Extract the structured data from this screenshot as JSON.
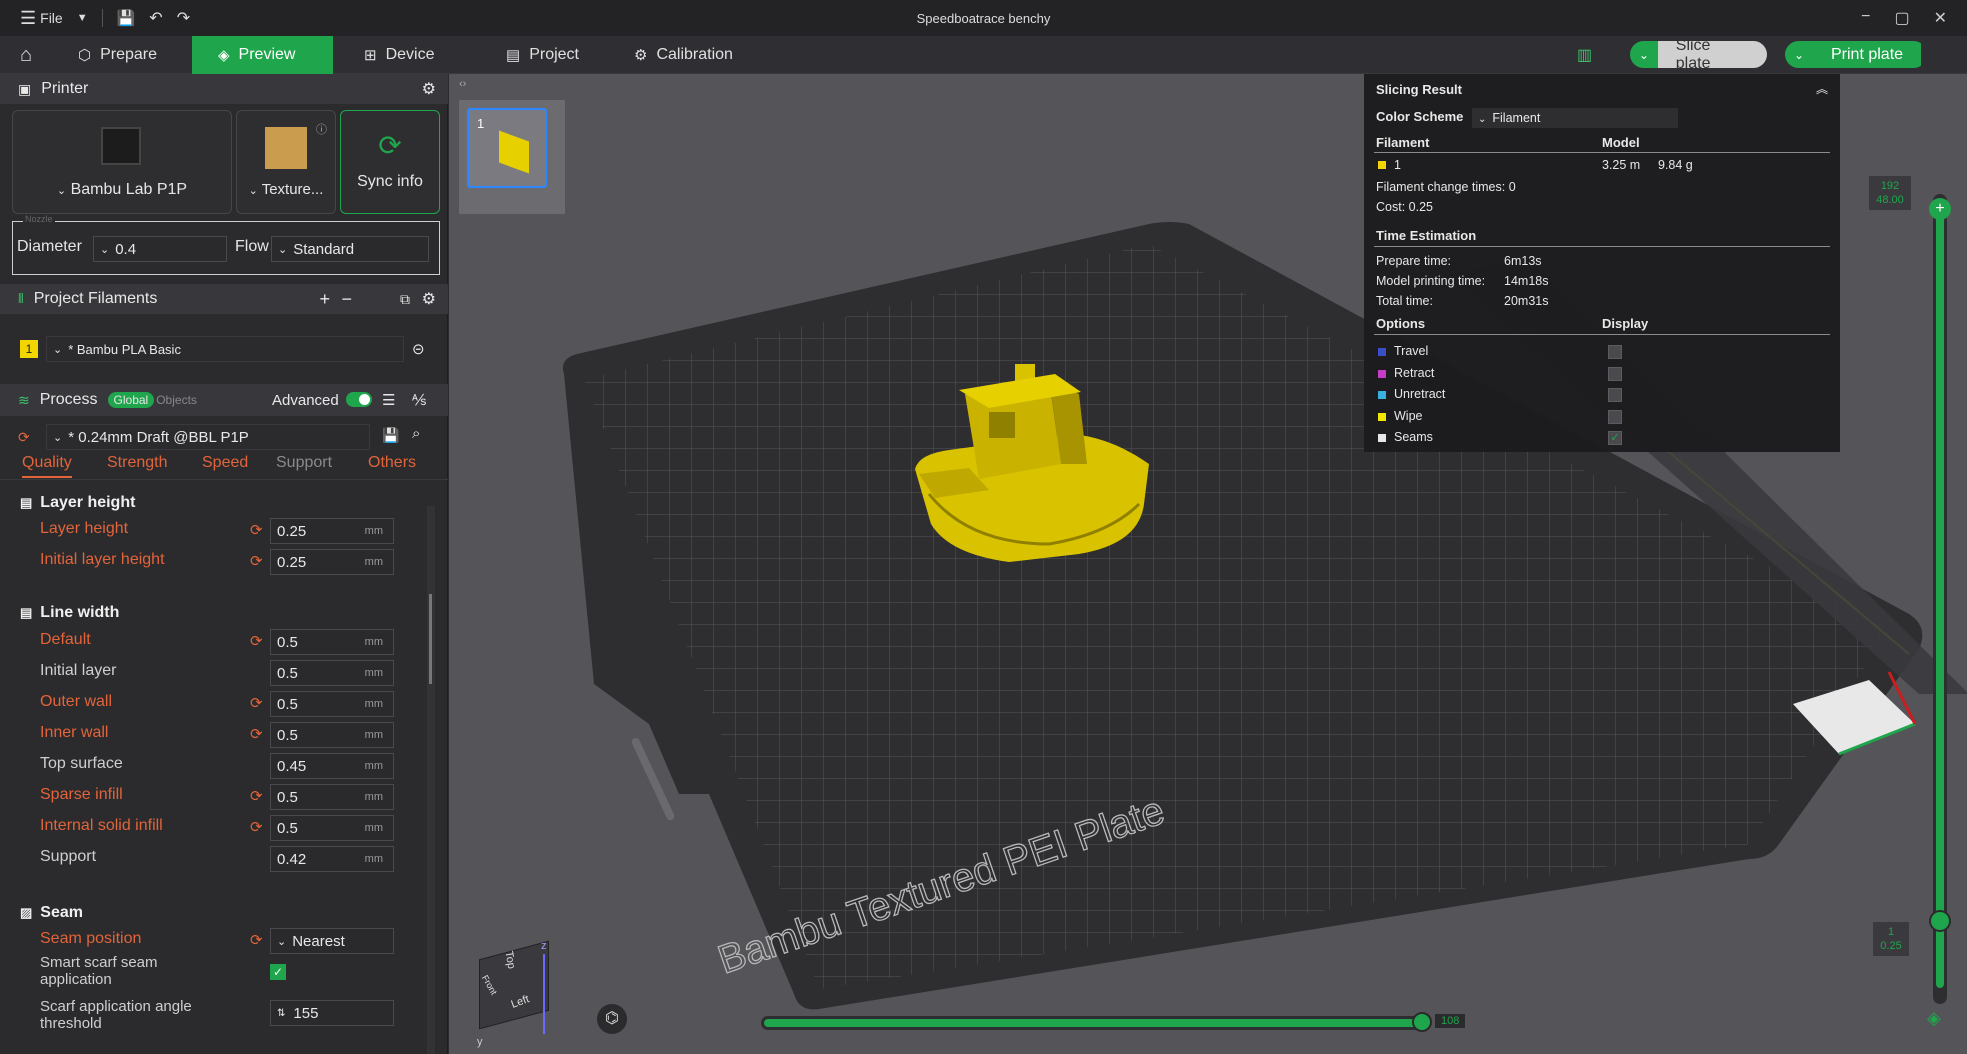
{
  "window": {
    "file_menu": "File",
    "title": "Speedboatrace benchy"
  },
  "tabs": {
    "prepare": "Prepare",
    "preview": "Preview",
    "device": "Device",
    "project": "Project",
    "calibration": "Calibration"
  },
  "actions": {
    "slice": "Slice plate",
    "print": "Print plate"
  },
  "printer": {
    "section": "Printer",
    "model": "Bambu Lab P1P",
    "plate": "Texture...",
    "sync": "Sync info",
    "nozzle_label": "Nozzle",
    "diameter_label": "Diameter",
    "diameter_value": "0.4",
    "flow_label": "Flow",
    "flow_value": "Standard"
  },
  "filaments": {
    "section": "Project Filaments",
    "index": "1",
    "name": "* Bambu PLA Basic",
    "color": "#f2d600"
  },
  "process": {
    "section": "Process",
    "global": "Global",
    "objects": "Objects",
    "advanced": "Advanced",
    "preset": "* 0.24mm Draft @BBL P1P",
    "tabs": [
      "Quality",
      "Strength",
      "Speed",
      "Support",
      "Others"
    ]
  },
  "settings": {
    "layer_height_group": "Layer height",
    "layer_height_label": "Layer height",
    "layer_height_value": "0.25",
    "initial_layer_height_label": "Initial layer height",
    "initial_layer_height_value": "0.25",
    "line_width_group": "Line width",
    "default_label": "Default",
    "default_value": "0.5",
    "initial_layer_label": "Initial layer",
    "initial_layer_value": "0.5",
    "outer_wall_label": "Outer wall",
    "outer_wall_value": "0.5",
    "inner_wall_label": "Inner wall",
    "inner_wall_value": "0.5",
    "top_surface_label": "Top surface",
    "top_surface_value": "0.45",
    "sparse_infill_label": "Sparse infill",
    "sparse_infill_value": "0.5",
    "internal_solid_label": "Internal solid infill",
    "internal_solid_value": "0.5",
    "support_label": "Support",
    "support_value": "0.42",
    "seam_group": "Seam",
    "seam_position_label": "Seam position",
    "seam_position_value": "Nearest",
    "smart_scarf_label": "Smart scarf seam application",
    "scarf_angle_label": "Scarf application angle threshold",
    "scarf_angle_value": "155",
    "unit": "mm"
  },
  "plate_thumb": {
    "number": "1"
  },
  "slicing_result": {
    "title": "Slicing Result",
    "color_scheme_label": "Color Scheme",
    "color_scheme_value": "Filament",
    "filament_header": "Filament",
    "model_header": "Model",
    "filament_index": "1",
    "length": "3.25 m",
    "weight": "9.84 g",
    "change_times": "Filament change times:  0",
    "cost": "Cost:  0.25",
    "time_header": "Time Estimation",
    "prepare_label": "Prepare time:",
    "prepare_value": "6m13s",
    "model_time_label": "Model printing time:",
    "model_time_value": "14m18s",
    "total_label": "Total time:",
    "total_value": "20m31s",
    "options_header": "Options",
    "display_header": "Display",
    "options": [
      {
        "name": "Travel",
        "color": "#3a4ec8",
        "checked": false
      },
      {
        "name": "Retract",
        "color": "#c83ac8",
        "checked": false
      },
      {
        "name": "Unretract",
        "color": "#3ab0e0",
        "checked": false
      },
      {
        "name": "Wipe",
        "color": "#f2e600",
        "checked": false
      },
      {
        "name": "Seams",
        "color": "#e6e6e6",
        "checked": true
      }
    ]
  },
  "layer_slider": {
    "top_layer": "192",
    "top_height": "48.00",
    "bottom_layer": "1",
    "bottom_height": "0.25"
  },
  "move_slider": {
    "value": "108"
  },
  "plate_label": "Bambu Textured PEI Plate",
  "view_cube": {
    "top": "Top",
    "left": "Left",
    "front": "Front",
    "axis_z": "z",
    "axis_y": "y"
  }
}
